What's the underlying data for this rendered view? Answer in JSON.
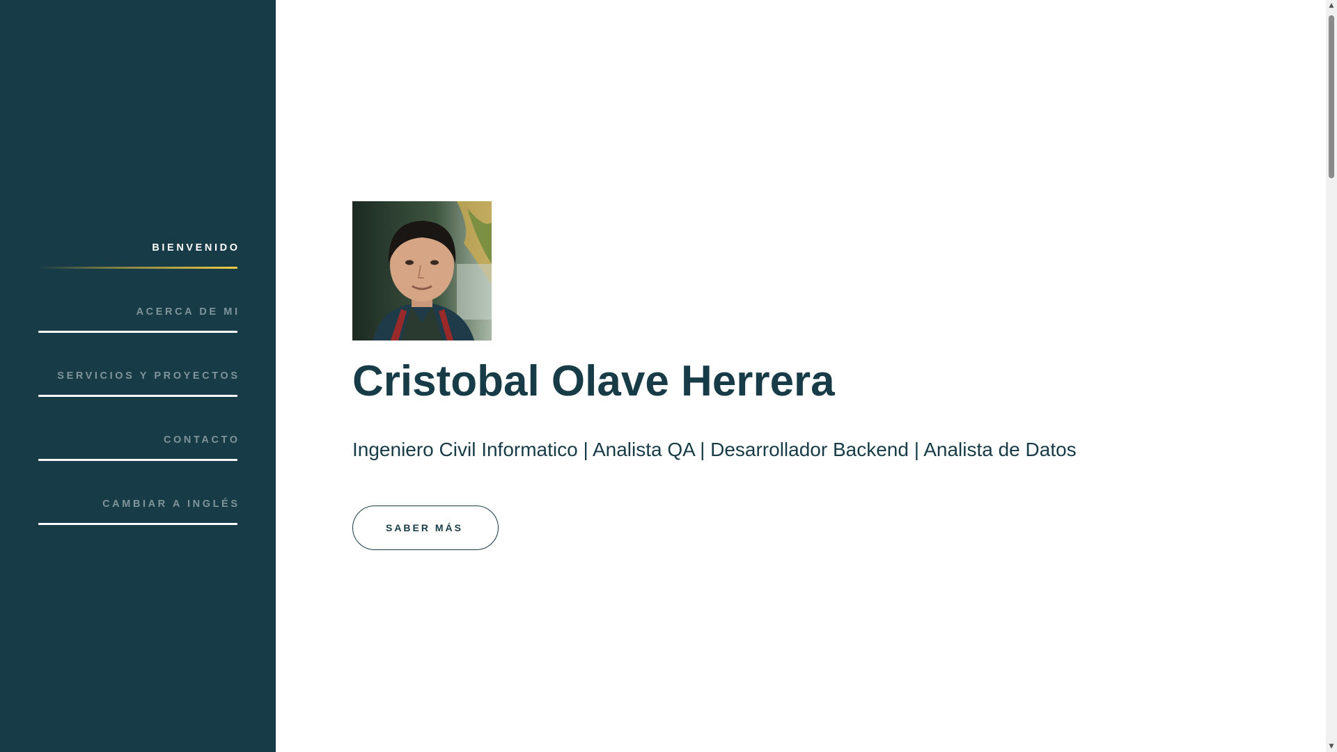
{
  "sidebar": {
    "background": "#173b47",
    "accent": "#f1cc45",
    "items": [
      {
        "label": "BIENVENIDO",
        "active": true
      },
      {
        "label": "ACERCA DE MI",
        "active": false
      },
      {
        "label": "SERVICIOS Y PROYECTOS",
        "active": false
      },
      {
        "label": "CONTACTO",
        "active": false
      },
      {
        "label": "CAMBIAR A INGLÉS",
        "active": false
      }
    ]
  },
  "hero": {
    "name": "Cristobal Olave Herrera",
    "tagline": "Ingeniero Civil Informatico | Analista QA | Desarrollador Backend | Analista de Datos",
    "cta_label": "SABER MÁS",
    "text_color": "#173b47"
  },
  "scrollbar": {
    "up_icon": "▲",
    "down_icon": "▼"
  }
}
